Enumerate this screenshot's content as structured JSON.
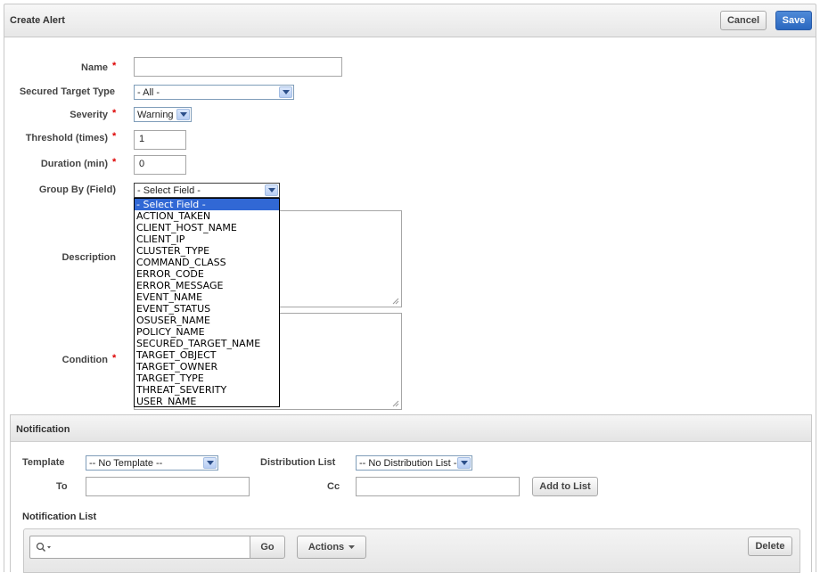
{
  "header": {
    "title": "Create Alert",
    "cancel_label": "Cancel",
    "save_label": "Save"
  },
  "form": {
    "name": {
      "label": "Name",
      "required": "*",
      "value": ""
    },
    "secured_target_type": {
      "label": "Secured Target Type",
      "selected": "- All -"
    },
    "severity": {
      "label": "Severity",
      "required": "*",
      "selected": "Warning"
    },
    "threshold": {
      "label": "Threshold (times)",
      "required": "*",
      "value": "1"
    },
    "duration": {
      "label": "Duration (min)",
      "required": "*",
      "value": "0"
    },
    "group_by": {
      "label": "Group By (Field)",
      "selected": "- Select Field -",
      "options": [
        "- Select Field -",
        "ACTION_TAKEN",
        "CLIENT_HOST_NAME",
        "CLIENT_IP",
        "CLUSTER_TYPE",
        "COMMAND_CLASS",
        "ERROR_CODE",
        "ERROR_MESSAGE",
        "EVENT_NAME",
        "EVENT_STATUS",
        "OSUSER_NAME",
        "POLICY_NAME",
        "SECURED_TARGET_NAME",
        "TARGET_OBJECT",
        "TARGET_OWNER",
        "TARGET_TYPE",
        "THREAT_SEVERITY",
        "USER_NAME"
      ]
    },
    "description": {
      "label": "Description"
    },
    "condition": {
      "label": "Condition",
      "required": "*"
    }
  },
  "notification": {
    "title": "Notification",
    "template": {
      "label": "Template",
      "selected": "-- No Template --"
    },
    "distribution_list": {
      "label": "Distribution List",
      "selected": "-- No Distribution List --"
    },
    "to": {
      "label": "To",
      "value": ""
    },
    "cc": {
      "label": "Cc",
      "value": ""
    },
    "add_to_list_label": "Add to List",
    "list_title": "Notification List",
    "toolbar": {
      "search_value": "",
      "go_label": "Go",
      "actions_label": "Actions",
      "delete_label": "Delete"
    }
  },
  "colors": {
    "primary_button": "#2a67bf",
    "required_marker": "#dd0000",
    "dropdown_highlight": "#3168d5"
  }
}
